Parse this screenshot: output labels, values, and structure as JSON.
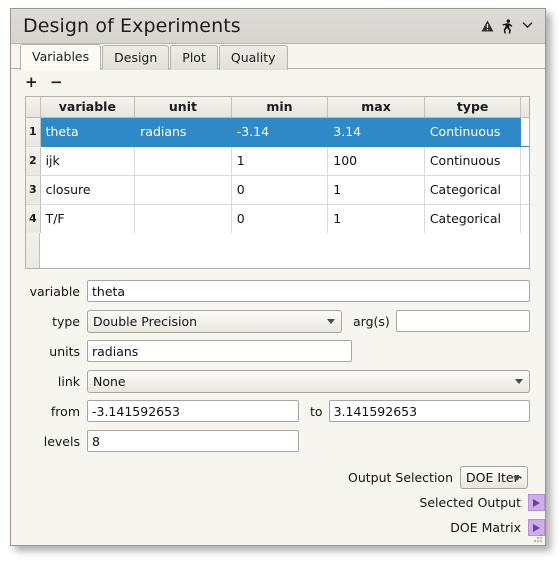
{
  "window": {
    "title": "Design of Experiments",
    "titlebar_icons": [
      {
        "name": "warning-triangle-icon",
        "glyph": "▲"
      },
      {
        "name": "run-person-icon",
        "glyph": "🏃"
      },
      {
        "name": "chevron-down-icon",
        "glyph": "⌄"
      }
    ]
  },
  "tabs": [
    {
      "label": "Variables",
      "active": true
    },
    {
      "label": "Design",
      "active": false
    },
    {
      "label": "Plot",
      "active": false
    },
    {
      "label": "Quality",
      "active": false
    }
  ],
  "toolbar": {
    "add_label": "+",
    "remove_label": "−"
  },
  "table": {
    "row_header_label": "",
    "columns": [
      "variable",
      "unit",
      "min",
      "max",
      "type"
    ],
    "rows": [
      {
        "index": "1",
        "variable": "theta",
        "unit": "radians",
        "min": "-3.14",
        "max": "3.14",
        "type": "Continuous",
        "selected": true
      },
      {
        "index": "2",
        "variable": "ijk",
        "unit": "",
        "min": "1",
        "max": "100",
        "type": "Continuous",
        "selected": false
      },
      {
        "index": "3",
        "variable": "closure",
        "unit": "",
        "min": "0",
        "max": "1",
        "type": "Categorical",
        "selected": false
      },
      {
        "index": "4",
        "variable": "T/F",
        "unit": "",
        "min": "0",
        "max": "1",
        "type": "Categorical",
        "selected": false
      }
    ]
  },
  "form": {
    "variable": {
      "label": "variable",
      "value": "theta",
      "placeholder": ""
    },
    "type": {
      "label": "type",
      "value": "Double Precision"
    },
    "args": {
      "label": "arg(s)",
      "value": "",
      "placeholder": ""
    },
    "units": {
      "label": "units",
      "value": "radians",
      "placeholder": ""
    },
    "link": {
      "label": "link",
      "value": "None"
    },
    "from": {
      "label": "from",
      "value": "-3.141592653",
      "placeholder": ""
    },
    "to": {
      "label": "to",
      "value": "3.141592653",
      "placeholder": ""
    },
    "levels": {
      "label": "levels",
      "value": "8",
      "placeholder": ""
    }
  },
  "bottom": {
    "output_selection_label": "Output Selection",
    "output_selection_value": "DOE Iter·",
    "ports": [
      {
        "label": "Selected Output",
        "name": "port-selected-output"
      },
      {
        "label": "DOE Matrix",
        "name": "port-doe-matrix"
      }
    ]
  },
  "colors": {
    "selection_blue": "#2f89c7",
    "panel_bg": "#f7f5f0",
    "titlebar_bg": "#d9d7d2",
    "port_purple": "#cdaee8",
    "port_arrow": "#6c3fa8"
  }
}
